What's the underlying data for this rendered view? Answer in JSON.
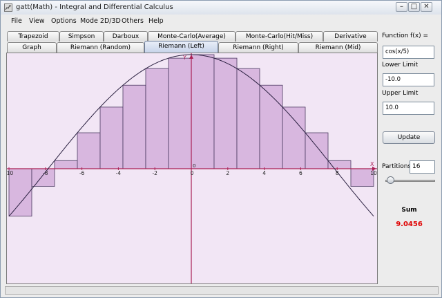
{
  "window": {
    "title": "gatt(Math) - Integral and Differential Calculus"
  },
  "menu": [
    "File",
    "View",
    "Options",
    "Mode 2D/3D",
    "Others",
    "Help"
  ],
  "tabs_row1": [
    "Trapezoid",
    "Simpson",
    "Darboux",
    "Monte-Carlo(Average)",
    "Monte-Carlo(Hit/Miss)",
    "Derivative"
  ],
  "tabs_row2": [
    "Graph",
    "Riemann (Random)",
    "Riemann (Left)",
    "Riemann (Right)",
    "Riemann (Mid)"
  ],
  "selected_tab": "Riemann (Left)",
  "side": {
    "function_label": "Function f(x) =",
    "function_value": "cos(x/5)",
    "lower_label": "Lower Limit",
    "lower_value": "-10.0",
    "upper_label": "Upper Limit",
    "upper_value": "10.0",
    "update_label": "Update",
    "partitions_label": "Partitions",
    "partitions_value": "16",
    "sum_label": "Sum",
    "sum_value": "9.0456",
    "sum_color": "#e00000"
  },
  "chart_data": {
    "type": "area",
    "function": "cos(x/5)",
    "method": "Riemann (Left)",
    "xlim": [
      -10,
      10
    ],
    "ylim": [
      -1,
      1
    ],
    "partitions": 16,
    "x_tick_labels": [
      "-10",
      "-8",
      "-6",
      "-4",
      "-2",
      "0",
      "2",
      "4",
      "6",
      "8",
      "10"
    ],
    "y_tick_labels": [
      "0",
      "-1"
    ],
    "xlabel": "X",
    "ylabel": "Y",
    "rect_left_x": [
      -10,
      -8.75,
      -7.5,
      -6.25,
      -5,
      -3.75,
      -2.5,
      -1.25,
      0,
      1.25,
      2.5,
      3.75,
      5,
      6.25,
      7.5,
      8.75
    ],
    "rect_heights": [
      -0.416,
      -0.155,
      0.071,
      0.315,
      0.54,
      0.732,
      0.878,
      0.969,
      1.0,
      0.969,
      0.878,
      0.732,
      0.54,
      0.315,
      0.071,
      -0.155
    ],
    "colors": {
      "background": "#f2e6f5",
      "bar_fill": "#d8b7df",
      "bar_stroke": "#4a3a60",
      "axis": "#aa2055",
      "curve": "#2a2040"
    }
  }
}
